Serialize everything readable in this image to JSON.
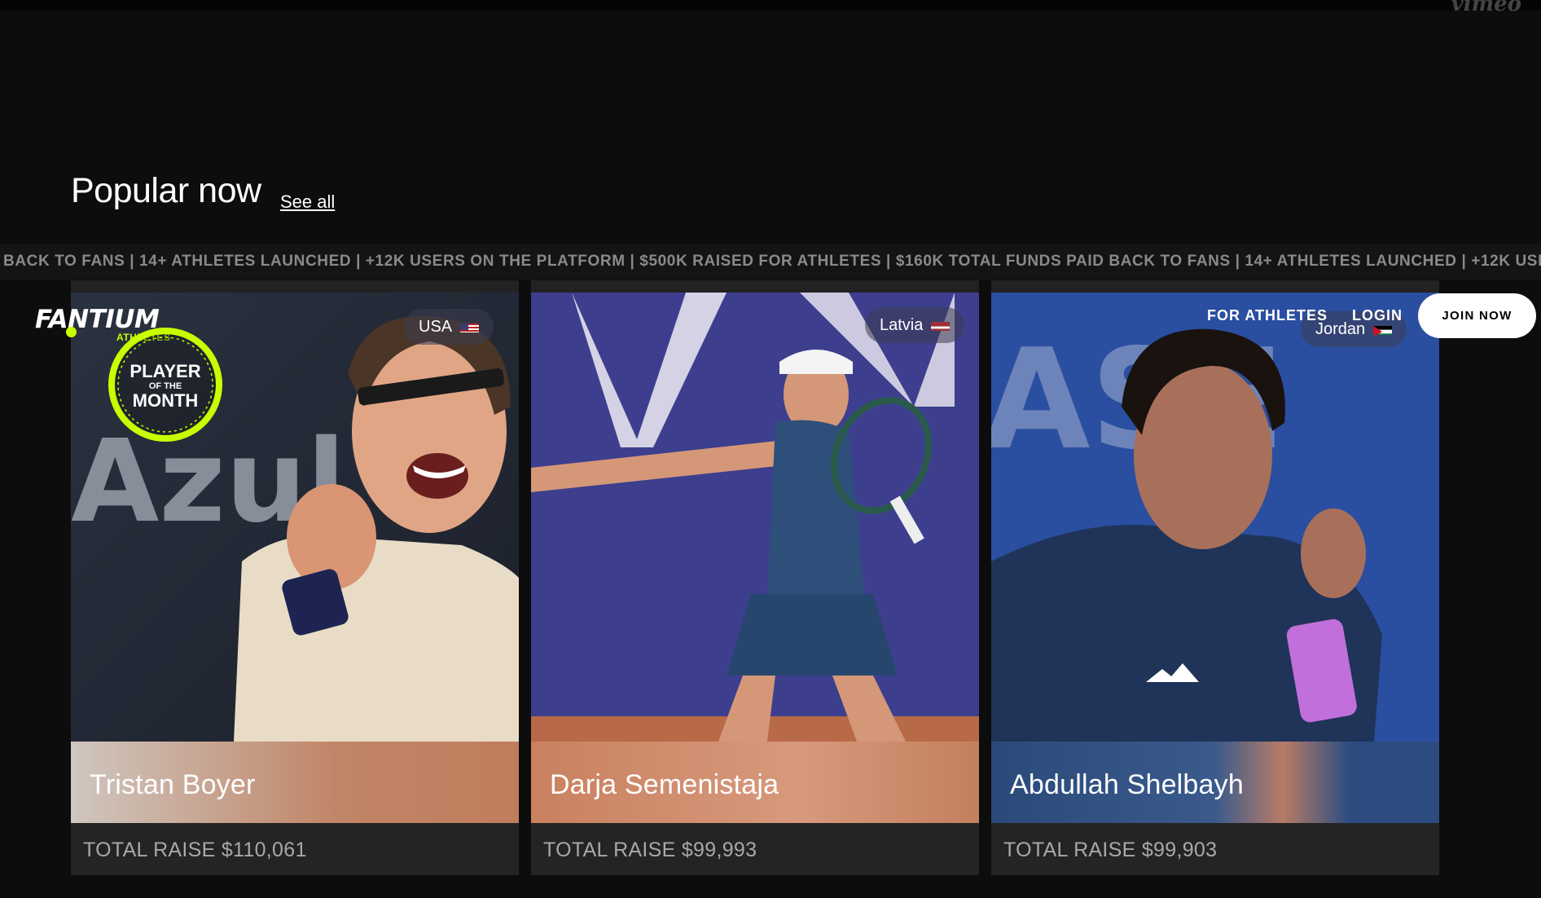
{
  "top": {
    "vimeo_logo": "vimeo"
  },
  "section": {
    "title": "Popular now",
    "see_all": "See all"
  },
  "ticker": {
    "text": "BACK TO FANS | 14+ ATHLETES LAUNCHED | +12K USERS ON THE PLATFORM | $500K RAISED FOR ATHLETES | $160K TOTAL FUNDS PAID BACK TO FANS | 14+ ATHLETES LAUNCHED | +12K USERS ON THE PLATFORM"
  },
  "header": {
    "logo": "FANTIUM",
    "logo_sub": "ATHLETES",
    "nav": [
      "FOR ATHLETES",
      "LOGIN"
    ],
    "join": "JOIN NOW"
  },
  "potm_badge": {
    "line1": "PLAYER",
    "line2": "OF THE",
    "line3": "MONTH"
  },
  "cards": [
    {
      "name": "Tristan Boyer",
      "country": "USA",
      "raise": "TOTAL RAISE $110,061",
      "flag_icon": "us-flag-icon",
      "accent": "#d8845a"
    },
    {
      "name": "Darja Semenistaja",
      "country": "Latvia",
      "raise": "TOTAL RAISE $99,993",
      "flag_icon": "latvia-flag-icon",
      "accent": "#c27a58"
    },
    {
      "name": "Abdullah Shelbayh",
      "country": "Jordan",
      "raise": "TOTAL RAISE $99,903",
      "flag_icon": "jordan-flag-icon",
      "accent": "#2c4a7c"
    }
  ]
}
